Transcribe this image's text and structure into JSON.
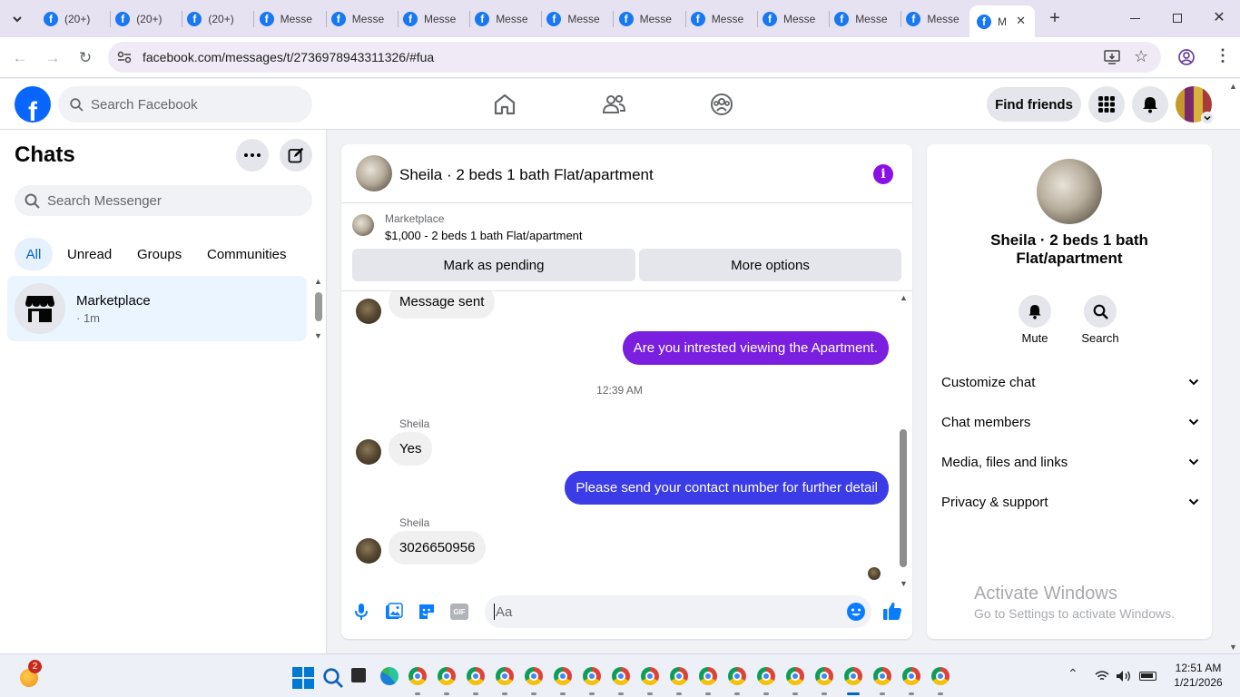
{
  "browser": {
    "tabs": [
      {
        "label": "(20+)"
      },
      {
        "label": "(20+)"
      },
      {
        "label": "(20+)"
      },
      {
        "label": "Messe"
      },
      {
        "label": "Messe"
      },
      {
        "label": "Messe"
      },
      {
        "label": "Messe"
      },
      {
        "label": "Messe"
      },
      {
        "label": "Messe"
      },
      {
        "label": "Messe"
      },
      {
        "label": "Messe"
      },
      {
        "label": "Messe"
      },
      {
        "label": "Messe"
      }
    ],
    "active_tab_label": "M",
    "url": "facebook.com/messages/t/2736978943311326/#fua"
  },
  "fb_top": {
    "logo_letter": "f",
    "search_placeholder": "Search Facebook",
    "find_friends": "Find friends"
  },
  "left": {
    "title": "Chats",
    "search_placeholder": "Search Messenger",
    "filters": [
      "All",
      "Unread",
      "Groups",
      "Communities"
    ],
    "chat": {
      "name": "Marketplace",
      "meta": "· 1m"
    }
  },
  "conversation": {
    "title": "Sheila · 2 beds 1 bath Flat/apartment",
    "marketplace_label": "Marketplace",
    "listing": "$1,000 - 2 beds 1 bath Flat/apartment",
    "mark_pending": "Mark as pending",
    "more_options": "More options",
    "messages": {
      "m1": "Message sent",
      "m2": "Are you intrested viewing the Apartment.",
      "timestamp": "12:39 AM",
      "sender1": "Sheila",
      "m3": "Yes",
      "m4": "Please send your contact number for further detail",
      "sender2": "Sheila",
      "m5": "3026650956"
    },
    "composer_placeholder": "Aa",
    "accent": "#7a1fe0",
    "accent2": "#3b3be8"
  },
  "right": {
    "name": "Sheila · 2 beds 1 bath Flat/apartment",
    "mute": "Mute",
    "search": "Search",
    "sections": [
      "Customize chat",
      "Chat members",
      "Media, files and links",
      "Privacy & support"
    ],
    "watermark_title": "Activate Windows",
    "watermark_sub": "Go to Settings to activate Windows."
  },
  "taskbar": {
    "badge": "2",
    "time": "12:51 AM",
    "date": "1/21/2026"
  }
}
